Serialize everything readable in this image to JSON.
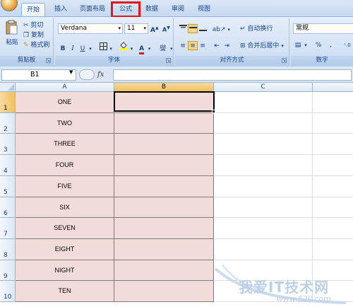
{
  "tabs": [
    {
      "label": "开始",
      "active": true
    },
    {
      "label": "插入"
    },
    {
      "label": "页面布局"
    },
    {
      "label": "公式",
      "highlighted": true
    },
    {
      "label": "数据"
    },
    {
      "label": "审阅"
    },
    {
      "label": "视图"
    }
  ],
  "clipboard": {
    "paste": "粘贴",
    "cut": "剪切",
    "copy": "复制",
    "format_painter": "格式刷",
    "group_label": "剪贴板"
  },
  "font": {
    "name": "Verdana",
    "size": "11",
    "grow": "A",
    "shrink": "A",
    "bold": "B",
    "italic": "I",
    "underline": "U",
    "group_label": "字体",
    "fill_color": "#ffff00",
    "font_color": "#e01818",
    "phonetic": "燮"
  },
  "alignment": {
    "wrap_text": "自动换行",
    "merge_center": "合并后居中",
    "group_label": "对齐方式"
  },
  "number": {
    "format": "常规",
    "percent": "%",
    "group_label": "数字"
  },
  "formula_bar": {
    "name_box": "B1",
    "fx": "fx",
    "value": ""
  },
  "columns": [
    "A",
    "B",
    "C"
  ],
  "rows": [
    {
      "num": "1",
      "a": "ONE"
    },
    {
      "num": "2",
      "a": "TWO"
    },
    {
      "num": "3",
      "a": "THREE"
    },
    {
      "num": "4",
      "a": "FOUR"
    },
    {
      "num": "5",
      "a": "FIVE"
    },
    {
      "num": "6",
      "a": "SIX"
    },
    {
      "num": "7",
      "a": "SEVEN"
    },
    {
      "num": "8",
      "a": "EIGHT"
    },
    {
      "num": "9",
      "a": "NIGHT"
    },
    {
      "num": "10",
      "a": "TEN"
    }
  ],
  "selected_cell": "B1",
  "colors": {
    "highlight": "#e01818",
    "cell_fill": "#f2dcdb",
    "selected_header": "#f5c867"
  },
  "watermark": {
    "text": "我爱IT技术网",
    "url": "www.52ij.com"
  }
}
